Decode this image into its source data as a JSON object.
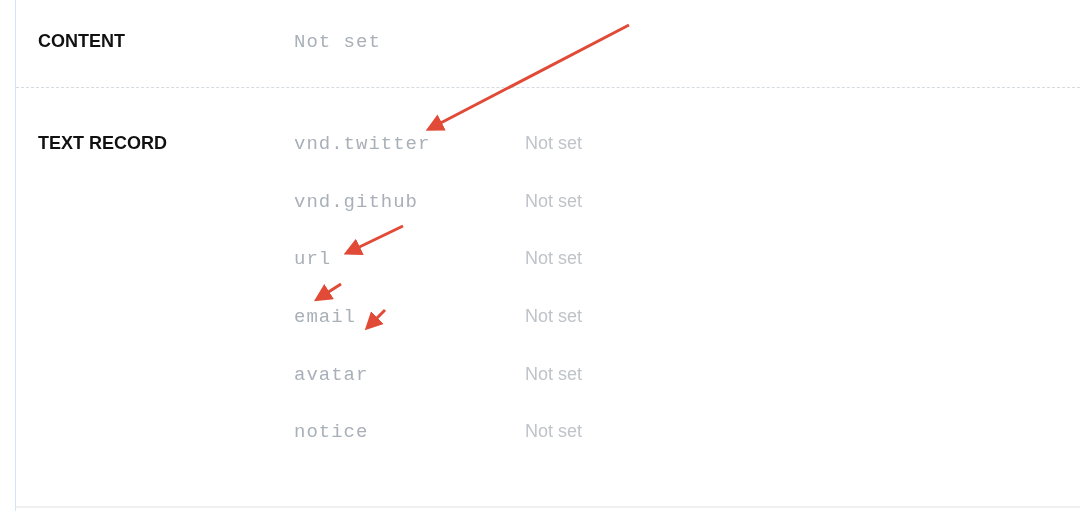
{
  "content": {
    "label": "CONTENT",
    "value": "Not set"
  },
  "text_record": {
    "label": "TEXT RECORD",
    "records": [
      {
        "key": "vnd.twitter",
        "value": "Not set"
      },
      {
        "key": "vnd.github",
        "value": "Not set"
      },
      {
        "key": "url",
        "value": "Not set"
      },
      {
        "key": "email",
        "value": "Not set"
      },
      {
        "key": "avatar",
        "value": "Not set"
      },
      {
        "key": "notice",
        "value": "Not set"
      }
    ]
  }
}
